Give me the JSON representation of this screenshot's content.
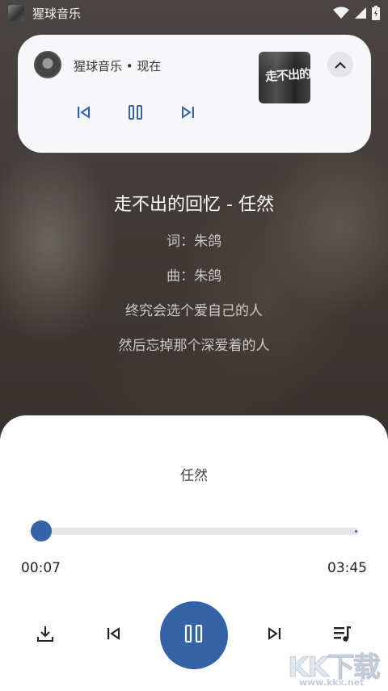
{
  "status_bar": {
    "app_name": "猩球音乐",
    "icons": [
      "wifi-icon",
      "signal-icon",
      "battery-icon"
    ]
  },
  "notification": {
    "title": "猩球音乐 • 现在",
    "cover_text": "走不出的",
    "controls": [
      "previous-icon",
      "pause-icon",
      "next-icon"
    ],
    "expand_icon": "chevron-up-icon"
  },
  "lyrics": {
    "title": "走不出的回忆 - 任然",
    "lines": [
      "词：朱鸽",
      "曲：朱鸽",
      "终究会选个爱自己的人",
      "然后忘掉那个深爱着的人"
    ]
  },
  "player": {
    "artist": "任然",
    "current_time": "00:07",
    "total_time": "03:45",
    "progress": 0.031,
    "controls": [
      "download-icon",
      "previous-icon",
      "pause-icon",
      "next-icon",
      "playlist-icon"
    ]
  },
  "watermark": {
    "text": "KK下载",
    "url": "www.kkx.net"
  },
  "colors": {
    "accent": "#3463a8",
    "sheet_background": "#ffffff",
    "card_background": "#f7f7f9"
  }
}
